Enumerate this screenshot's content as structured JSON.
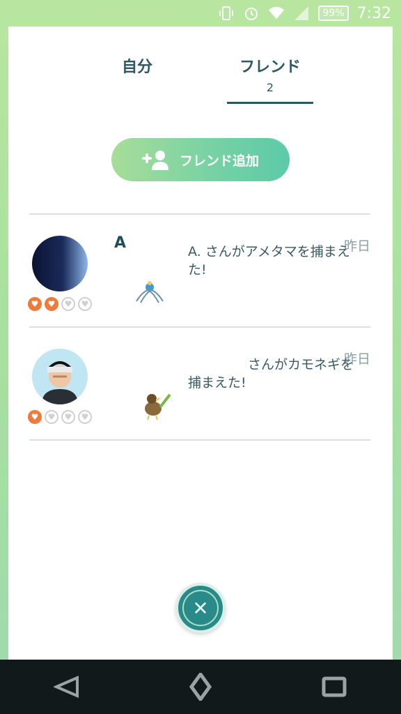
{
  "status_bar": {
    "battery": "99%",
    "time": "7:32"
  },
  "tabs": [
    {
      "label": "自分"
    },
    {
      "label": "フレンド",
      "count": "2"
    }
  ],
  "add_friend_button": {
    "label": "フレンド追加"
  },
  "feed": [
    {
      "name": "A",
      "time": "昨日",
      "message": "A.             さんがアメタマを捕まえた!",
      "hearts": [
        true,
        true,
        false,
        false
      ],
      "pokemon_icon": "amemata-icon"
    },
    {
      "name": "",
      "time": "昨日",
      "message": "さんがカモネギを捕まえた!",
      "hearts": [
        true,
        false,
        false,
        false
      ],
      "pokemon_icon": "farfetchd-icon"
    }
  ],
  "close_button": {
    "icon": "close-icon"
  },
  "nav": {
    "back": "back-icon",
    "home": "home-icon",
    "recents": "recents-icon"
  },
  "colors": {
    "accent": "#2d5863",
    "button_gradient_start": "#a8dd98",
    "button_gradient_end": "#5ccaa8",
    "heart_full": "#f07a3a"
  }
}
